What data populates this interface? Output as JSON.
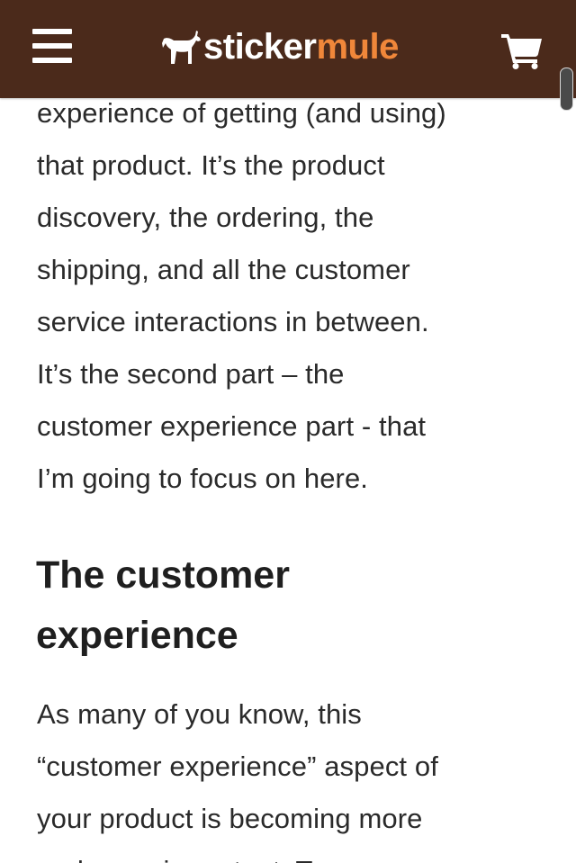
{
  "header": {
    "brand_part1": "sticker",
    "brand_part2": "mule",
    "brand_colors": {
      "background": "#4b2a1b",
      "accent": "#f0873a",
      "text": "#ffffff"
    },
    "menu_icon": "hamburger-menu-icon",
    "logo_icon": "mule-logo-icon",
    "cart_icon": "shopping-cart-icon"
  },
  "article": {
    "paragraph_1": "experience of getting (and using)\nthat product. It’s the product\ndiscovery, the ordering, the\nshipping, and all the customer\nservice interactions in between.\nIt’s the second part – the\ncustomer experience part - that\nI’m going to focus on here.",
    "heading": "The customer\nexperience",
    "paragraph_2": "As many of you know, this\n“customer experience” aspect of\nyour product is becoming more\nand more important. To"
  }
}
